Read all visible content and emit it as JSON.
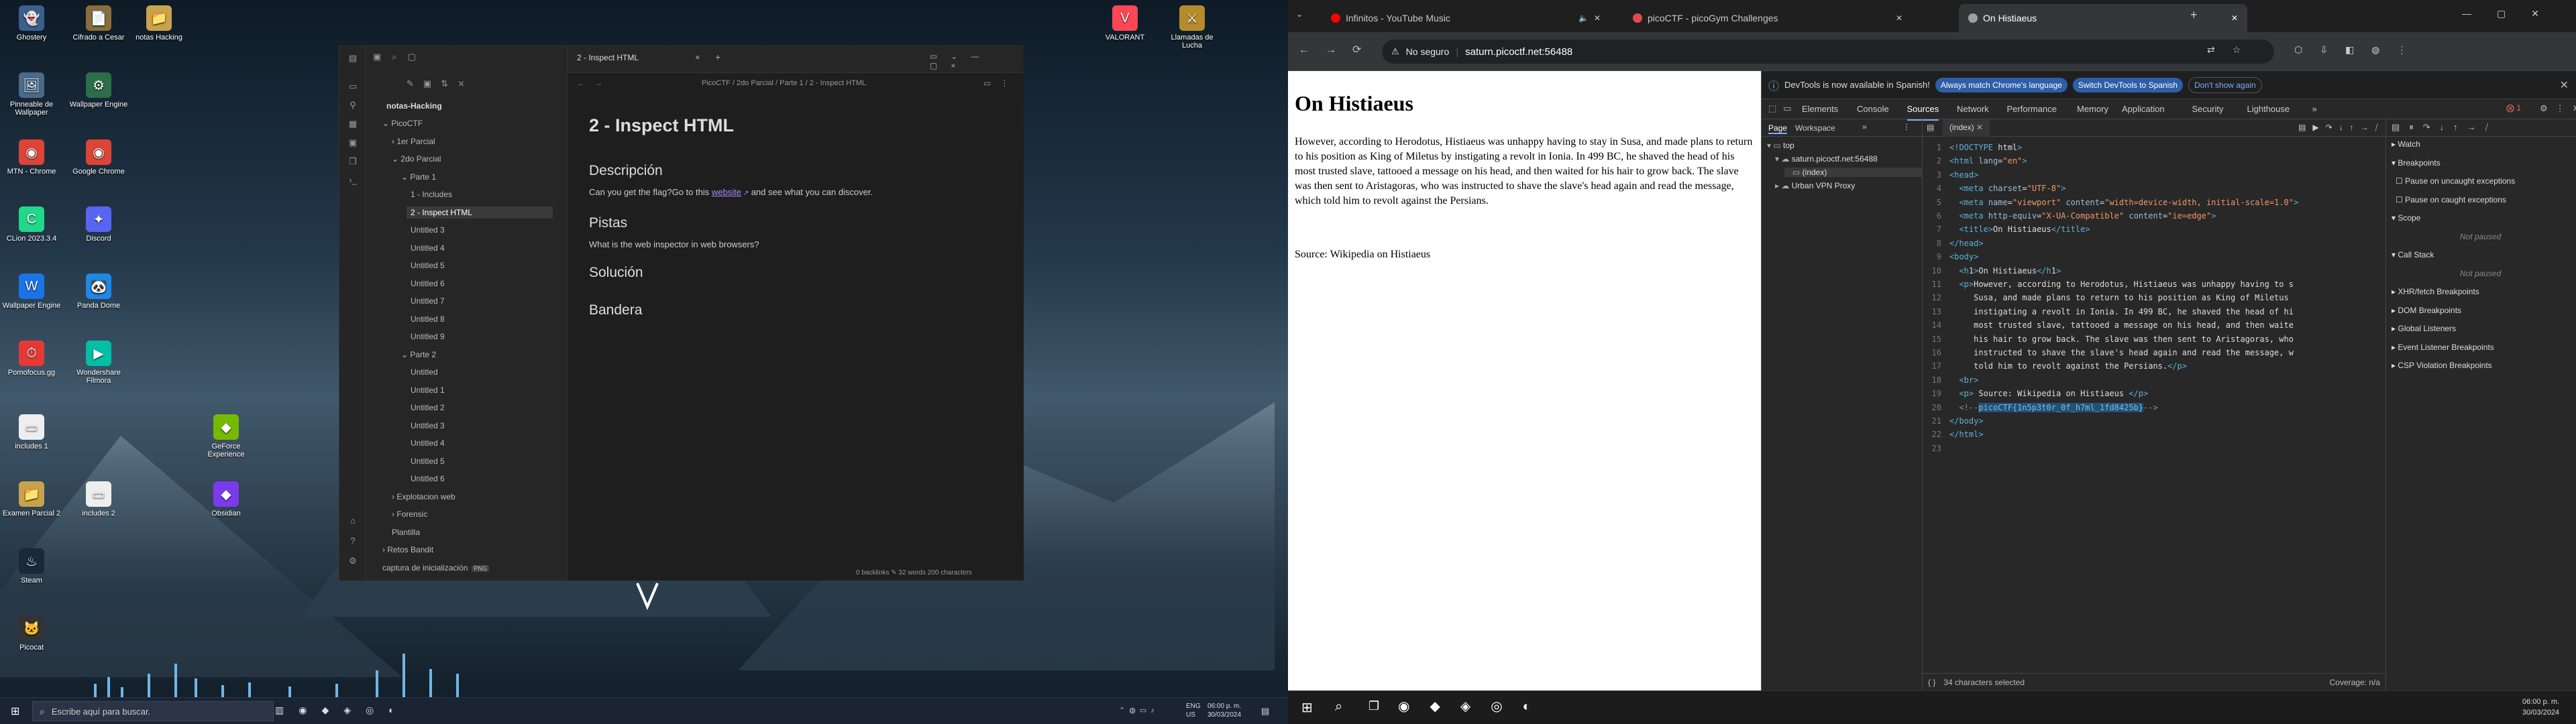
{
  "left_desktop": {
    "icons": [
      {
        "label": "Ghostery",
        "name": "ghost-icon",
        "glyph": "👻",
        "color": "#3b5f8a"
      },
      {
        "label": "Cifrado a Cesar",
        "name": "cipher-icon",
        "glyph": "📄",
        "color": "#8a6d3b"
      },
      {
        "label": "notas Hacking",
        "name": "notes-icon",
        "glyph": "📁",
        "color": "#c9a24b"
      },
      {
        "label": "Pinneable de Wallpaper",
        "name": "wallpaper-icon",
        "glyph": "🖼",
        "color": "#4a6a8a"
      },
      {
        "label": "Wallpaper Engine",
        "name": "engine-icon",
        "glyph": "⚙",
        "color": "#2c6e49"
      },
      {
        "label": "MTN - Chrome",
        "name": "chrome-icon",
        "glyph": "◉",
        "color": "#db4437"
      },
      {
        "label": "Google Chrome",
        "name": "chrome-icon",
        "glyph": "◉",
        "color": "#db4437"
      },
      {
        "label": "CLion 2023.3.4",
        "name": "clion-icon",
        "glyph": "C",
        "color": "#21d789"
      },
      {
        "label": "Discord",
        "name": "discord-icon",
        "glyph": "✦",
        "color": "#5865f2"
      },
      {
        "label": "Wallpaper Engine",
        "name": "wallpaper-engine-icon",
        "glyph": "W",
        "color": "#1a73e8"
      },
      {
        "label": "Panda Dome",
        "name": "panda-icon",
        "glyph": "🐼",
        "color": "#1e88e5"
      },
      {
        "label": "Pomofocus.gg",
        "name": "pomo-icon",
        "glyph": "⏱",
        "color": "#e53935"
      },
      {
        "label": "Wondershare Filmora",
        "name": "filmora-icon",
        "glyph": "▶",
        "color": "#00bfa5"
      },
      {
        "label": "includes 1",
        "name": "file-icon",
        "glyph": "▭",
        "color": "#eeeeee"
      },
      {
        "label": "GeForce Experience",
        "name": "geforce-icon",
        "glyph": "◆",
        "color": "#76b900"
      },
      {
        "label": "Examen Parcial 2",
        "name": "folder-icon",
        "glyph": "📁",
        "color": "#c9a24b"
      },
      {
        "label": "includes 2",
        "name": "file-icon",
        "glyph": "▭",
        "color": "#eeeeee"
      },
      {
        "label": "Obsidian",
        "name": "obsidian-icon",
        "glyph": "◆",
        "color": "#7c3aed"
      },
      {
        "label": "Steam",
        "name": "steam-icon",
        "glyph": "♨",
        "color": "#1b2838"
      },
      {
        "label": "Picocat",
        "name": "pico-icon",
        "glyph": "🐱",
        "color": "#333"
      },
      {
        "label": "VALORANT",
        "name": "valorant-icon",
        "glyph": "V",
        "color": "#ff4655"
      },
      {
        "label": "Llamadas de Lucha",
        "name": "game-icon",
        "glyph": "⚔",
        "color": "#b58b2b"
      }
    ]
  },
  "obsidian": {
    "vault_name": "notas-Hacking",
    "tab_title": "2 - Inspect HTML",
    "breadcrumb": "PicoCTF / 2do Parcial / Parte 1 / 2 - Inspect HTML",
    "tree": [
      {
        "label": "PicoCTF",
        "level": 0,
        "folder": true
      },
      {
        "label": "1er Parcial",
        "level": 1,
        "folder": true
      },
      {
        "label": "2do Parcial",
        "level": 1,
        "folder": true
      },
      {
        "label": "Parte 1",
        "level": 2,
        "folder": true
      },
      {
        "label": "1 - Includes",
        "level": 3
      },
      {
        "label": "2 - Inspect HTML",
        "level": 3,
        "active": true
      },
      {
        "label": "Untitled 3",
        "level": 3
      },
      {
        "label": "Untitled 4",
        "level": 3
      },
      {
        "label": "Untitled 5",
        "level": 3
      },
      {
        "label": "Untitled 6",
        "level": 3
      },
      {
        "label": "Untitled 7",
        "level": 3
      },
      {
        "label": "Untitled 8",
        "level": 3
      },
      {
        "label": "Untitled 9",
        "level": 3
      },
      {
        "label": "Parte 2",
        "level": 2,
        "folder": true
      },
      {
        "label": "Untitled",
        "level": 3
      },
      {
        "label": "Untitled 1",
        "level": 3
      },
      {
        "label": "Untitled 2",
        "level": 3
      },
      {
        "label": "Untitled 3",
        "level": 3
      },
      {
        "label": "Untitled 4",
        "level": 3
      },
      {
        "label": "Untitled 5",
        "level": 3
      },
      {
        "label": "Untitled 6",
        "level": 3
      },
      {
        "label": "Explotacion web",
        "level": 1,
        "folder": true
      },
      {
        "label": "Forensic",
        "level": 1,
        "folder": true
      },
      {
        "label": "Plantilla",
        "level": 1
      },
      {
        "label": "Retos Bandit",
        "level": 0,
        "folder": true
      },
      {
        "label": "captura de inicialización",
        "level": 0,
        "badge": "PNG"
      }
    ],
    "note": {
      "title": "2 - Inspect HTML",
      "h_descripcion": "Descripción",
      "desc_text_before": "Can you get the flag?Go to this ",
      "desc_link": "website",
      "desc_text_after": " and see what you can discover.",
      "h_pistas": "Pistas",
      "pistas_text": "What is the web inspector in web browsers?",
      "h_solucion": "Solución",
      "h_bandera": "Bandera"
    },
    "status": {
      "backlinks": "0 backlinks",
      "words": "32 words",
      "chars": "200 characters"
    }
  },
  "left_taskbar": {
    "search_placeholder": "Escribe aquí para buscar.",
    "lang": "ENG",
    "region": "US",
    "time": "06:00 p. m.",
    "date": "30/03/2024"
  },
  "chrome": {
    "tabs": [
      {
        "label": "Infinitos - YouTube Music",
        "color": "#ff0000"
      },
      {
        "label": "picoCTF - picoGym Challenges",
        "color": "#e24a4a"
      },
      {
        "label": "On Histiaeus",
        "color": "#9aa0a6",
        "active": true
      }
    ],
    "security_label": "No seguro",
    "url": "saturn.picoctf.net:56488"
  },
  "web_page": {
    "h1": "On Histiaeus",
    "paragraph": "However, according to Herodotus, Histiaeus was unhappy having to stay in Susa, and made plans to return to his position as King of Miletus by instigating a revolt in Ionia. In 499 BC, he shaved the head of his most trusted slave, tattooed a message on his head, and then waited for his hair to grow back. The slave was then sent to Aristagoras, who was instructed to shave the slave's head again and read the message, which told him to revolt against the Persians.",
    "source": "Source: Wikipedia on Histiaeus"
  },
  "devtools": {
    "banner_text": "DevTools is now available in Spanish!",
    "banner_btn1": "Always match Chrome's language",
    "banner_btn2": "Switch DevTools to Spanish",
    "banner_btn3": "Don't show again",
    "tabs": [
      "Elements",
      "Console",
      "Sources",
      "Network",
      "Performance",
      "Memory",
      "Application",
      "Security",
      "Lighthouse"
    ],
    "active_tab": "Sources",
    "errors": "1",
    "nav_tabs": [
      "Page",
      "Workspace"
    ],
    "tree": [
      "top",
      "saturn.picoctf.net:56488",
      "(index)",
      "Urban VPN Proxy"
    ],
    "file_tab": "(index)",
    "code": [
      "<!DOCTYPE html>",
      "<html lang=\"en\">",
      "<head>",
      "  <meta charset=\"UTF-8\">",
      "  <meta name=\"viewport\" content=\"width=device-width, initial-scale=1.0\">",
      "  <meta http-equiv=\"X-UA-Compatible\" content=\"ie=edge\">",
      "  <title>On Histiaeus</title>",
      "</head>",
      "<body>",
      "  <h1>On Histiaeus</h1>",
      "  <p>However, according to Herodotus, Histiaeus was unhappy having to s",
      "     Susa, and made plans to return to his position as King of Miletus",
      "     instigating a revolt in Ionia. In 499 BC, he shaved the head of hi",
      "     most trusted slave, tattooed a message on his head, and then waite",
      "     his hair to grow back. The slave was then sent to Aristagoras, who",
      "     instructed to shave the slave's head again and read the message, w",
      "     told him to revolt against the Persians.</p>",
      "  <br>",
      "  <p> Source: Wikipedia on Histiaeus </p>",
      "  <!--picoCTF{1n5p3t0r_0f_h7ml_1fd8425b}-->",
      "</body>",
      "</html>",
      ""
    ],
    "selection_status": "34 characters selected",
    "coverage": "Coverage: n/a",
    "debugger": [
      {
        "label": "Watch",
        "type": "section"
      },
      {
        "label": "Breakpoints",
        "type": "section"
      },
      {
        "label": "Pause on uncaught exceptions",
        "type": "check"
      },
      {
        "label": "Pause on caught exceptions",
        "type": "check"
      },
      {
        "label": "Scope",
        "type": "section"
      },
      {
        "label": "Not paused",
        "type": "muted"
      },
      {
        "label": "Call Stack",
        "type": "section"
      },
      {
        "label": "Not paused",
        "type": "muted"
      },
      {
        "label": "XHR/fetch Breakpoints",
        "type": "section"
      },
      {
        "label": "DOM Breakpoints",
        "type": "section"
      },
      {
        "label": "Global Listeners",
        "type": "section"
      },
      {
        "label": "Event Listener Breakpoints",
        "type": "section"
      },
      {
        "label": "CSP Violation Breakpoints",
        "type": "section"
      }
    ]
  },
  "right_taskbar": {
    "time": "06:00 p. m.",
    "date": "30/03/2024"
  }
}
